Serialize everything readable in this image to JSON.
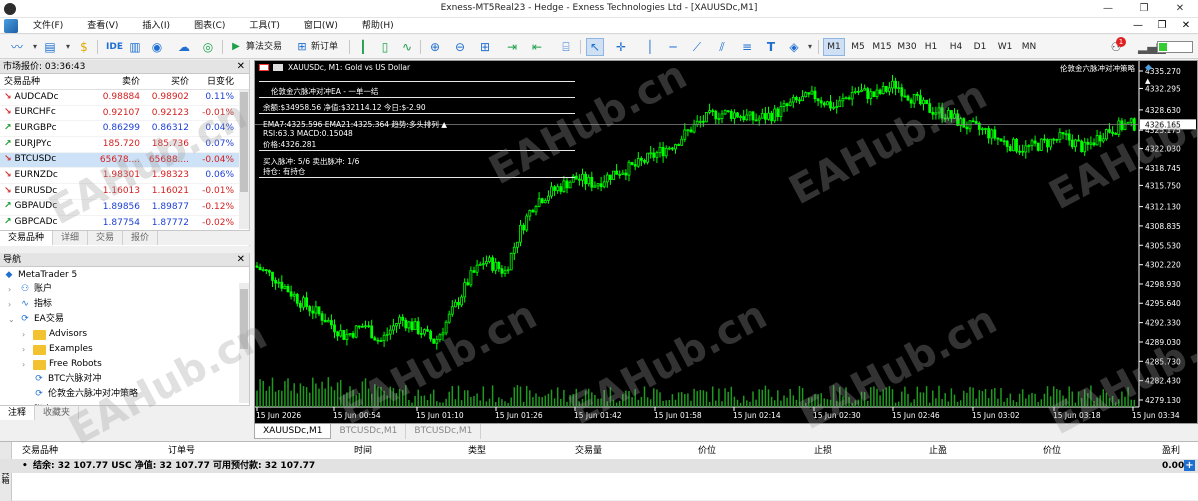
{
  "titlebar": {
    "title": "Exness-MT5Real23 - Hedge - Exness Technologies Ltd - [XAUUSDc,M1]",
    "min": "—",
    "max": "❐",
    "close": "✕"
  },
  "menu": {
    "items": [
      "文件(F)",
      "查看(V)",
      "插入(I)",
      "图表(C)",
      "工具(T)",
      "窗口(W)",
      "帮助(H)"
    ],
    "min": "—",
    "restore": "❐",
    "close": "✕"
  },
  "toolbar": {
    "algo_trading": "算法交易",
    "new_order": "新订单",
    "ide": "IDE",
    "timeframes": [
      "M1",
      "M5",
      "M15",
      "M30",
      "H1",
      "H4",
      "D1",
      "W1",
      "MN"
    ],
    "active_tf": "M1",
    "notify_count": "1"
  },
  "market_watch": {
    "title": "市场报价: 03:36:43",
    "headers": {
      "symbol": "交易品种",
      "bid": "卖价",
      "ask": "买价",
      "change": "日变化"
    },
    "rows": [
      {
        "dir": "down",
        "symbol": "AUDCADc",
        "bid": "0.98884",
        "ask": "0.98902",
        "change": "0.11%",
        "color": "red"
      },
      {
        "dir": "down",
        "symbol": "EURCHFc",
        "bid": "0.92107",
        "ask": "0.92123",
        "change": "-0.01%",
        "color": "red"
      },
      {
        "dir": "up",
        "symbol": "EURGBPc",
        "bid": "0.86299",
        "ask": "0.86312",
        "change": "0.04%",
        "color": "blue"
      },
      {
        "dir": "up",
        "symbol": "EURJPYc",
        "bid": "185.720",
        "ask": "185.736",
        "change": "0.07%",
        "color": "red"
      },
      {
        "dir": "down",
        "symbol": "BTCUSDc",
        "bid": "65678....",
        "ask": "65688....",
        "change": "-0.04%",
        "color": "red"
      },
      {
        "dir": "down",
        "symbol": "EURNZDc",
        "bid": "1.98301",
        "ask": "1.98323",
        "change": "0.06%",
        "color": "red"
      },
      {
        "dir": "down",
        "symbol": "EURUSDc",
        "bid": "1.16013",
        "ask": "1.16021",
        "change": "-0.01%",
        "color": "red"
      },
      {
        "dir": "up",
        "symbol": "GBPAUDc",
        "bid": "1.89856",
        "ask": "1.89877",
        "change": "-0.12%",
        "color": "blue"
      },
      {
        "dir": "up",
        "symbol": "GBPCADc",
        "bid": "1.87754",
        "ask": "1.87772",
        "change": "-0.02%",
        "color": "blue"
      }
    ],
    "tabs": [
      "交易品种",
      "详细",
      "交易",
      "报价"
    ]
  },
  "navigator": {
    "title": "导航",
    "root": "MetaTrader 5",
    "items": [
      {
        "label": "账户",
        "level": 1,
        "exp": "›",
        "icon": "accounts-icon"
      },
      {
        "label": "指标",
        "level": 1,
        "exp": "›",
        "icon": "indicators-icon"
      },
      {
        "label": "EA交易",
        "level": 1,
        "exp": "⌄",
        "icon": "expert-advisors-icon"
      },
      {
        "label": "Advisors",
        "level": 2,
        "exp": "›",
        "icon": "folder-icon"
      },
      {
        "label": "Examples",
        "level": 2,
        "exp": "›",
        "icon": "folder-icon"
      },
      {
        "label": "Free Robots",
        "level": 2,
        "exp": "›",
        "icon": "folder-icon"
      },
      {
        "label": "BTC六脉对冲",
        "level": 2,
        "exp": "",
        "icon": "ea-icon"
      },
      {
        "label": "伦敦金六脉冲对冲策略",
        "level": 2,
        "exp": "",
        "icon": "ea-icon"
      },
      {
        "label": "脚本",
        "level": 1,
        "exp": "›",
        "icon": "scripts-icon"
      }
    ],
    "tabs": [
      "注释",
      "收藏夹"
    ]
  },
  "chart": {
    "header": "XAUUSDc, M1:  Gold vs US Dollar",
    "ea_name": "伦敦金六脉冲对冲策略",
    "current_price": "4326.165",
    "overlay": {
      "title": "伦敦金六脉冲对冲EA - 一单一结",
      "balance": "余额:$34958.56  净值:$32114.12  今日:$-2.90",
      "ema": "EMA7:4325.596  EMA21:4325.364  趋势:多头排列 ▲",
      "rsi": "RSI:63.3  MACD:0.15048",
      "price": "价格:4326.281",
      "pulse": "买入脉冲: 5/6  卖出脉冲: 1/6",
      "position": "持仓: 有持仓"
    },
    "y_ticks": [
      "4335.270",
      "4332.295",
      "4328.630",
      "4325.175",
      "4322.030",
      "4318.745",
      "4315.750",
      "4312.130",
      "4308.835",
      "4305.530",
      "4302.220",
      "4298.930",
      "4295.640",
      "4292.330",
      "4289.030",
      "4285.730",
      "4282.430",
      "4279.130"
    ],
    "x_ticks": [
      "15 Jun 2026",
      "15 Jun 00:54",
      "15 Jun 01:10",
      "15 Jun 01:26",
      "15 Jun 01:42",
      "15 Jun 01:58",
      "15 Jun 02:14",
      "15 Jun 02:30",
      "15 Jun 02:46",
      "15 Jun 03:02",
      "15 Jun 03:18",
      "15 Jun 03:34"
    ],
    "tabs": [
      "XAUUSDc,M1",
      "BTCUSDc,M1",
      "BTCUSDc,M1"
    ],
    "watermark": "EAHub.cn"
  },
  "terminal": {
    "side_label": "工具箱",
    "headers": [
      "交易品种",
      "订单号",
      "时间",
      "类型",
      "交易量",
      "价位",
      "止损",
      "止盈",
      "价位",
      "盈利"
    ],
    "balance_line": "结余: 32 107.77 USC  净值: 32 107.77  可用预付款: 32 107.77",
    "profit": "0.00"
  },
  "colors": {
    "bull": "#00ff00",
    "bear": "#00ff00",
    "bg": "#000000",
    "volume": "#1f9a1f"
  }
}
